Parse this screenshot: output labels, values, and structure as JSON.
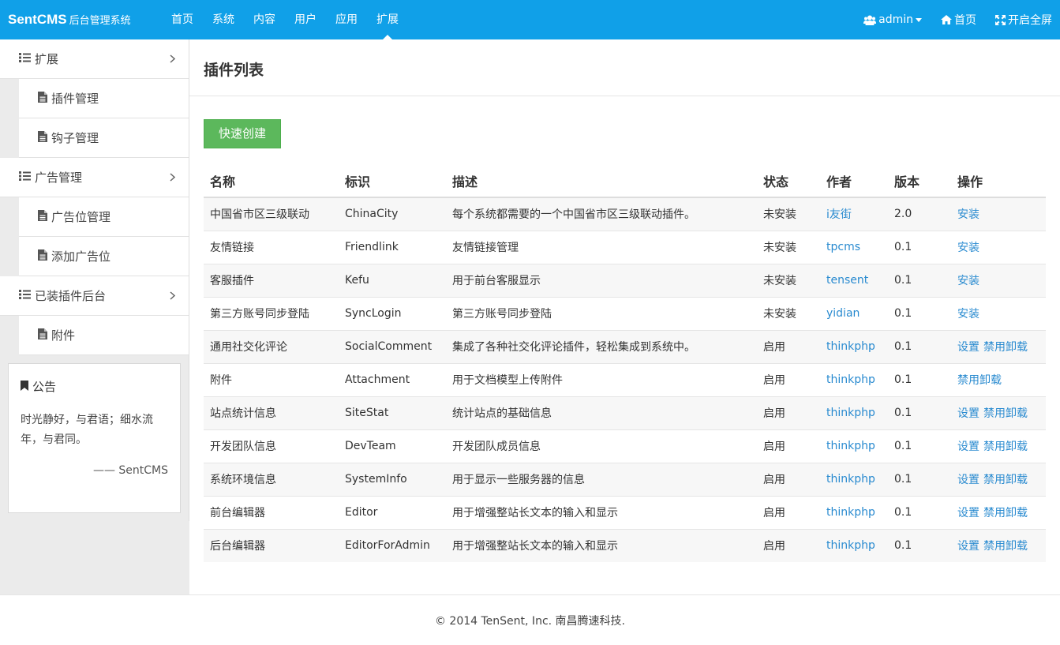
{
  "brand": {
    "name": "SentCMS",
    "subtitle": "后台管理系统"
  },
  "nav": [
    {
      "label": "首页"
    },
    {
      "label": "系统"
    },
    {
      "label": "内容"
    },
    {
      "label": "用户"
    },
    {
      "label": "应用"
    },
    {
      "label": "扩展",
      "active": true
    }
  ],
  "topright": {
    "user": "admin",
    "home": "首页",
    "fullscreen": "开启全屏"
  },
  "sidebar": {
    "groups": [
      {
        "label": "扩展",
        "items": [
          "插件管理",
          "钩子管理"
        ]
      },
      {
        "label": "广告管理",
        "items": [
          "广告位管理",
          "添加广告位"
        ]
      },
      {
        "label": "已装插件后台",
        "items": [
          "附件"
        ]
      }
    ]
  },
  "notice": {
    "title": "公告",
    "body": "时光静好，与君语；细水流年，与君同。",
    "signature": "—— SentCMS"
  },
  "main": {
    "title": "插件列表",
    "create_button": "快速创建",
    "columns": [
      "名称",
      "标识",
      "描述",
      "状态",
      "作者",
      "版本",
      "操作"
    ],
    "rows": [
      {
        "name": "中国省市区三级联动",
        "id": "ChinaCity",
        "desc": "每个系统都需要的一个中国省市区三级联动插件。",
        "status": "未安装",
        "author": "i友街",
        "version": "2.0",
        "ops": [
          "安装"
        ]
      },
      {
        "name": "友情链接",
        "id": "Friendlink",
        "desc": "友情链接管理",
        "status": "未安装",
        "author": "tpcms",
        "version": "0.1",
        "ops": [
          "安装"
        ]
      },
      {
        "name": "客服插件",
        "id": "Kefu",
        "desc": "用于前台客服显示",
        "status": "未安装",
        "author": "tensent",
        "version": "0.1",
        "ops": [
          "安装"
        ]
      },
      {
        "name": "第三方账号同步登陆",
        "id": "SyncLogin",
        "desc": "第三方账号同步登陆",
        "status": "未安装",
        "author": "yidian",
        "version": "0.1",
        "ops": [
          "安装"
        ]
      },
      {
        "name": "通用社交化评论",
        "id": "SocialComment",
        "desc": "集成了各种社交化评论插件，轻松集成到系统中。",
        "status": "启用",
        "author": "thinkphp",
        "version": "0.1",
        "ops": [
          "设置",
          "禁用",
          "卸载"
        ]
      },
      {
        "name": "附件",
        "id": "Attachment",
        "desc": "用于文档模型上传附件",
        "status": "启用",
        "author": "thinkphp",
        "version": "0.1",
        "ops": [
          "禁用",
          "卸载"
        ]
      },
      {
        "name": "站点统计信息",
        "id": "SiteStat",
        "desc": "统计站点的基础信息",
        "status": "启用",
        "author": "thinkphp",
        "version": "0.1",
        "ops": [
          "设置",
          "禁用",
          "卸载"
        ]
      },
      {
        "name": "开发团队信息",
        "id": "DevTeam",
        "desc": "开发团队成员信息",
        "status": "启用",
        "author": "thinkphp",
        "version": "0.1",
        "ops": [
          "设置",
          "禁用",
          "卸载"
        ]
      },
      {
        "name": "系统环境信息",
        "id": "SystemInfo",
        "desc": "用于显示一些服务器的信息",
        "status": "启用",
        "author": "thinkphp",
        "version": "0.1",
        "ops": [
          "设置",
          "禁用",
          "卸载"
        ]
      },
      {
        "name": "前台编辑器",
        "id": "Editor",
        "desc": "用于增强整站长文本的输入和显示",
        "status": "启用",
        "author": "thinkphp",
        "version": "0.1",
        "ops": [
          "设置",
          "禁用",
          "卸载"
        ]
      },
      {
        "name": "后台编辑器",
        "id": "EditorForAdmin",
        "desc": "用于增强整站长文本的输入和显示",
        "status": "启用",
        "author": "thinkphp",
        "version": "0.1",
        "ops": [
          "设置",
          "禁用",
          "卸载"
        ]
      }
    ]
  },
  "footer": {
    "text": "© 2014 TenSent, Inc. 南昌腾速科技."
  },
  "colors": {
    "topbar": "#10a0e8",
    "link": "#2a8bd0",
    "create_button": "#5cb85c"
  },
  "icons": {
    "list": "list-icon",
    "file": "file-icon",
    "chevron": "chevron-right-icon",
    "users": "users-icon",
    "home": "home-icon",
    "expand": "expand-icon",
    "bookmark": "bookmark-icon"
  }
}
